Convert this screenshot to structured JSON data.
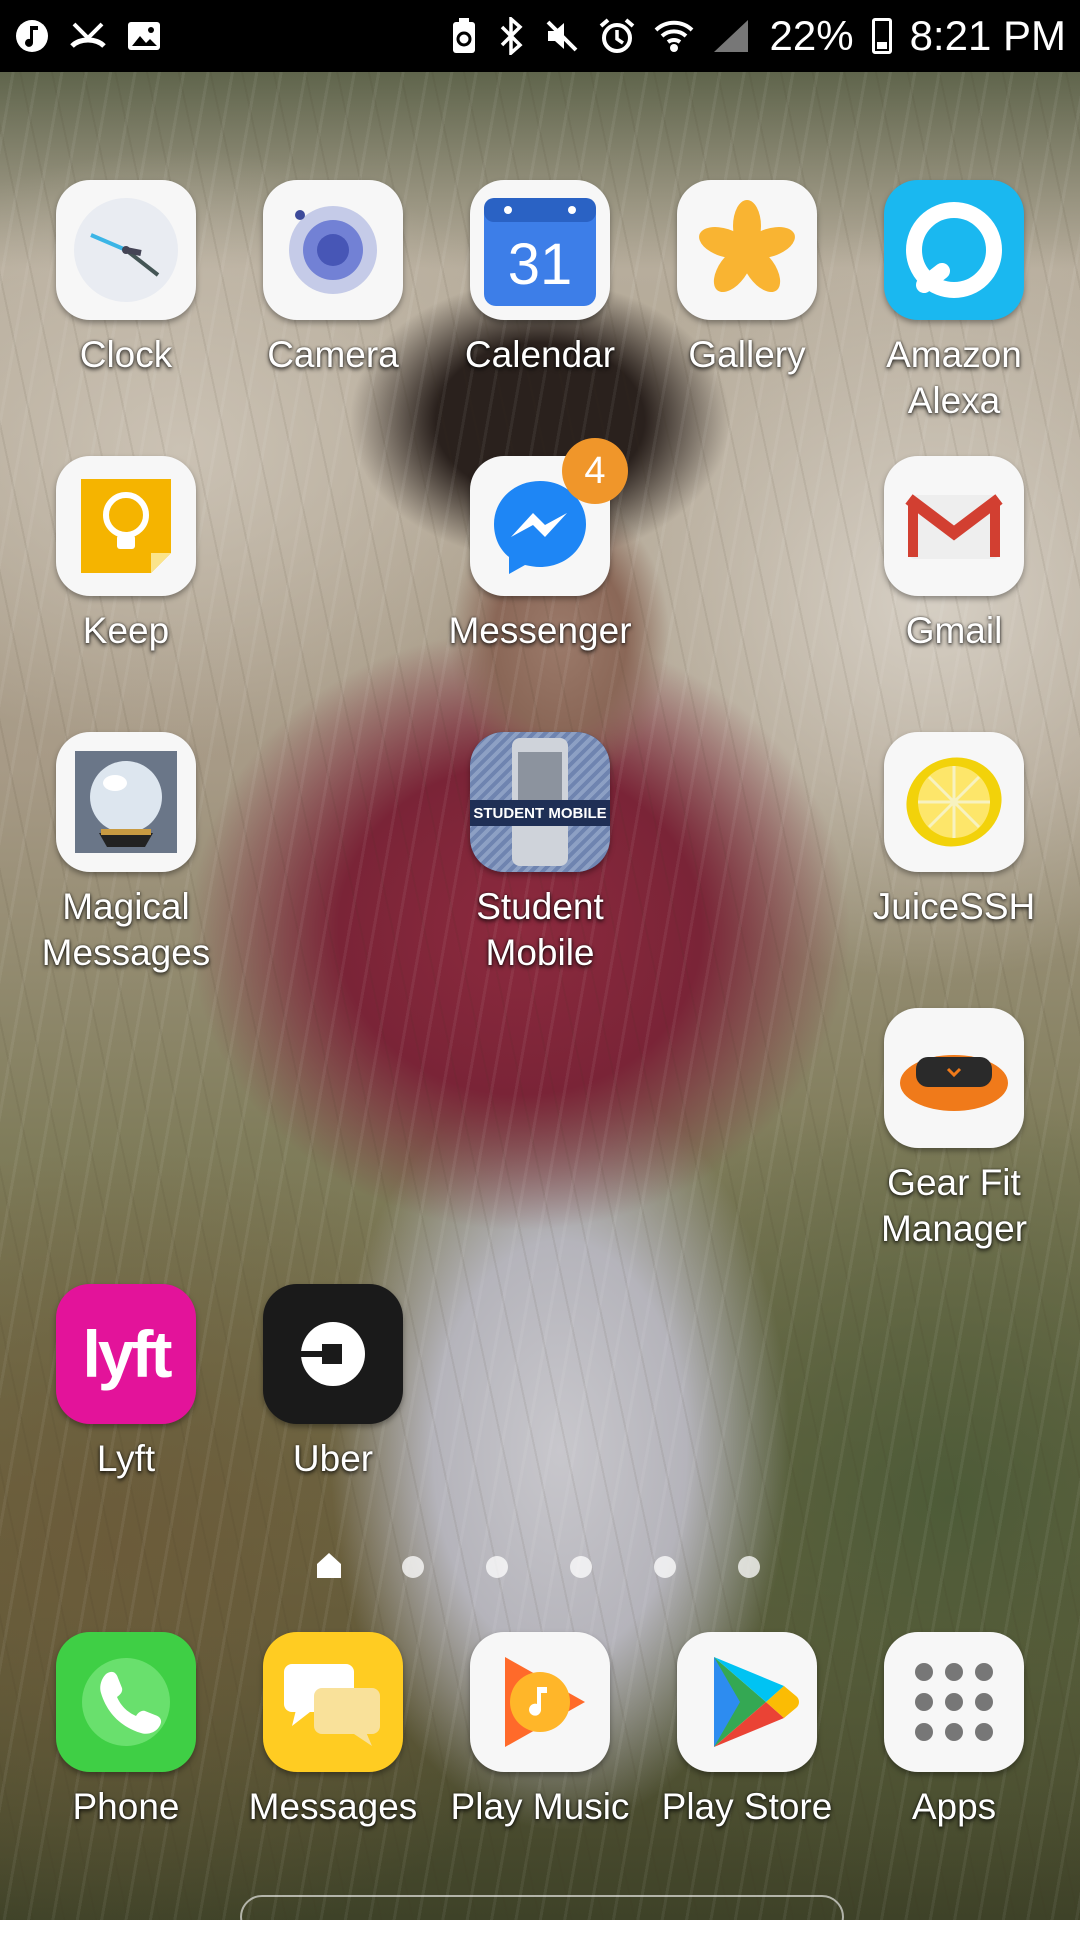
{
  "status_bar": {
    "battery": "22%",
    "time": "8:21 PM",
    "left_icons": [
      "music-note-icon",
      "missed-call-icon",
      "image-notification-icon"
    ],
    "right_icons": [
      "battery-saver-icon",
      "bluetooth-icon",
      "mute-icon",
      "alarm-icon",
      "wifi-icon",
      "signal-icon"
    ]
  },
  "apps": {
    "clock": "Clock",
    "camera": "Camera",
    "calendar": {
      "label": "Calendar",
      "day": "31"
    },
    "gallery": "Gallery",
    "alexa": [
      "Amazon",
      "Alexa"
    ],
    "keep": "Keep",
    "messenger": {
      "label": "Messenger",
      "badge": "4"
    },
    "gmail": "Gmail",
    "magical": [
      "Magical",
      "Messages"
    ],
    "student_mobile": {
      "lines": [
        "Student",
        "Mobile"
      ],
      "tile_text": "STUDENT MOBILE"
    },
    "juicessh": "JuiceSSH",
    "gearfit": [
      "Gear Fit",
      "Manager"
    ],
    "lyft": {
      "label": "Lyft",
      "logo": "lyft"
    },
    "uber": "Uber"
  },
  "pager": {
    "pages": 6,
    "current": 0
  },
  "dock": {
    "phone": "Phone",
    "messages": "Messages",
    "play_music": "Play Music",
    "play_store": "Play Store",
    "apps": "Apps"
  },
  "colors": {
    "lyft": "#e3139a",
    "messenger_badge": "#f0962a",
    "alexa": "#1ab8f0",
    "phone": "#3fcf45",
    "messages": "#ffcc22"
  }
}
